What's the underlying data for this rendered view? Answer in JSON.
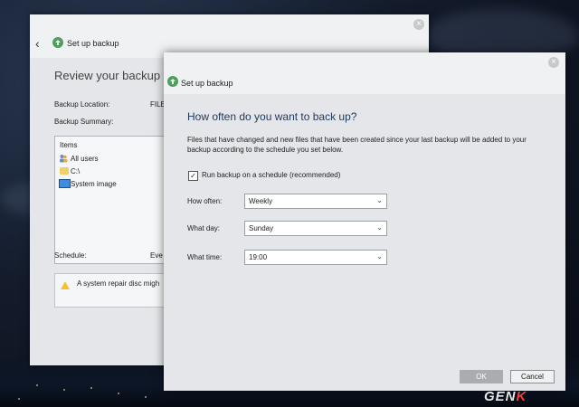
{
  "watermark": {
    "text_main": "GEN",
    "text_accent": "K"
  },
  "back_window": {
    "title": "Set up backup",
    "heading": "Review your backup sett",
    "backup_location_label": "Backup Location:",
    "backup_location_value": "FILE",
    "backup_summary_label": "Backup Summary:",
    "items_header": "Items",
    "items": [
      "All users",
      "C:\\",
      "System image"
    ],
    "schedule_label": "Schedule:",
    "schedule_value": "Eve",
    "warning_text": "A system repair disc migh"
  },
  "dialog": {
    "title": "Set up backup",
    "heading": "How often do you want to back up?",
    "description": "Files that have changed and new files that have been created since your last backup will be added to your backup according to the schedule you set below.",
    "run_on_schedule_label": "Run backup on a schedule (recommended)",
    "run_on_schedule_checked": true,
    "how_often_label": "How often:",
    "how_often_value": "Weekly",
    "what_day_label": "What day:",
    "what_day_value": "Sunday",
    "what_time_label": "What time:",
    "what_time_value": "19:00",
    "ok_label": "OK",
    "cancel_label": "Cancel"
  },
  "colors": {
    "accent_heading": "#223a5e",
    "ok_disabled": "#a9acb0",
    "warning": "#f2c233",
    "folder": "#f1cf6a",
    "watermark_accent": "#e94040"
  },
  "icons": {
    "back": "back-arrow-icon",
    "title": "backup-icon",
    "close": "close-icon",
    "users": "users-icon",
    "drive": "folder-icon",
    "system_image": "monitor-icon",
    "warning": "warning-icon",
    "dropdown": "chevron-down-icon",
    "check": "check-icon"
  }
}
